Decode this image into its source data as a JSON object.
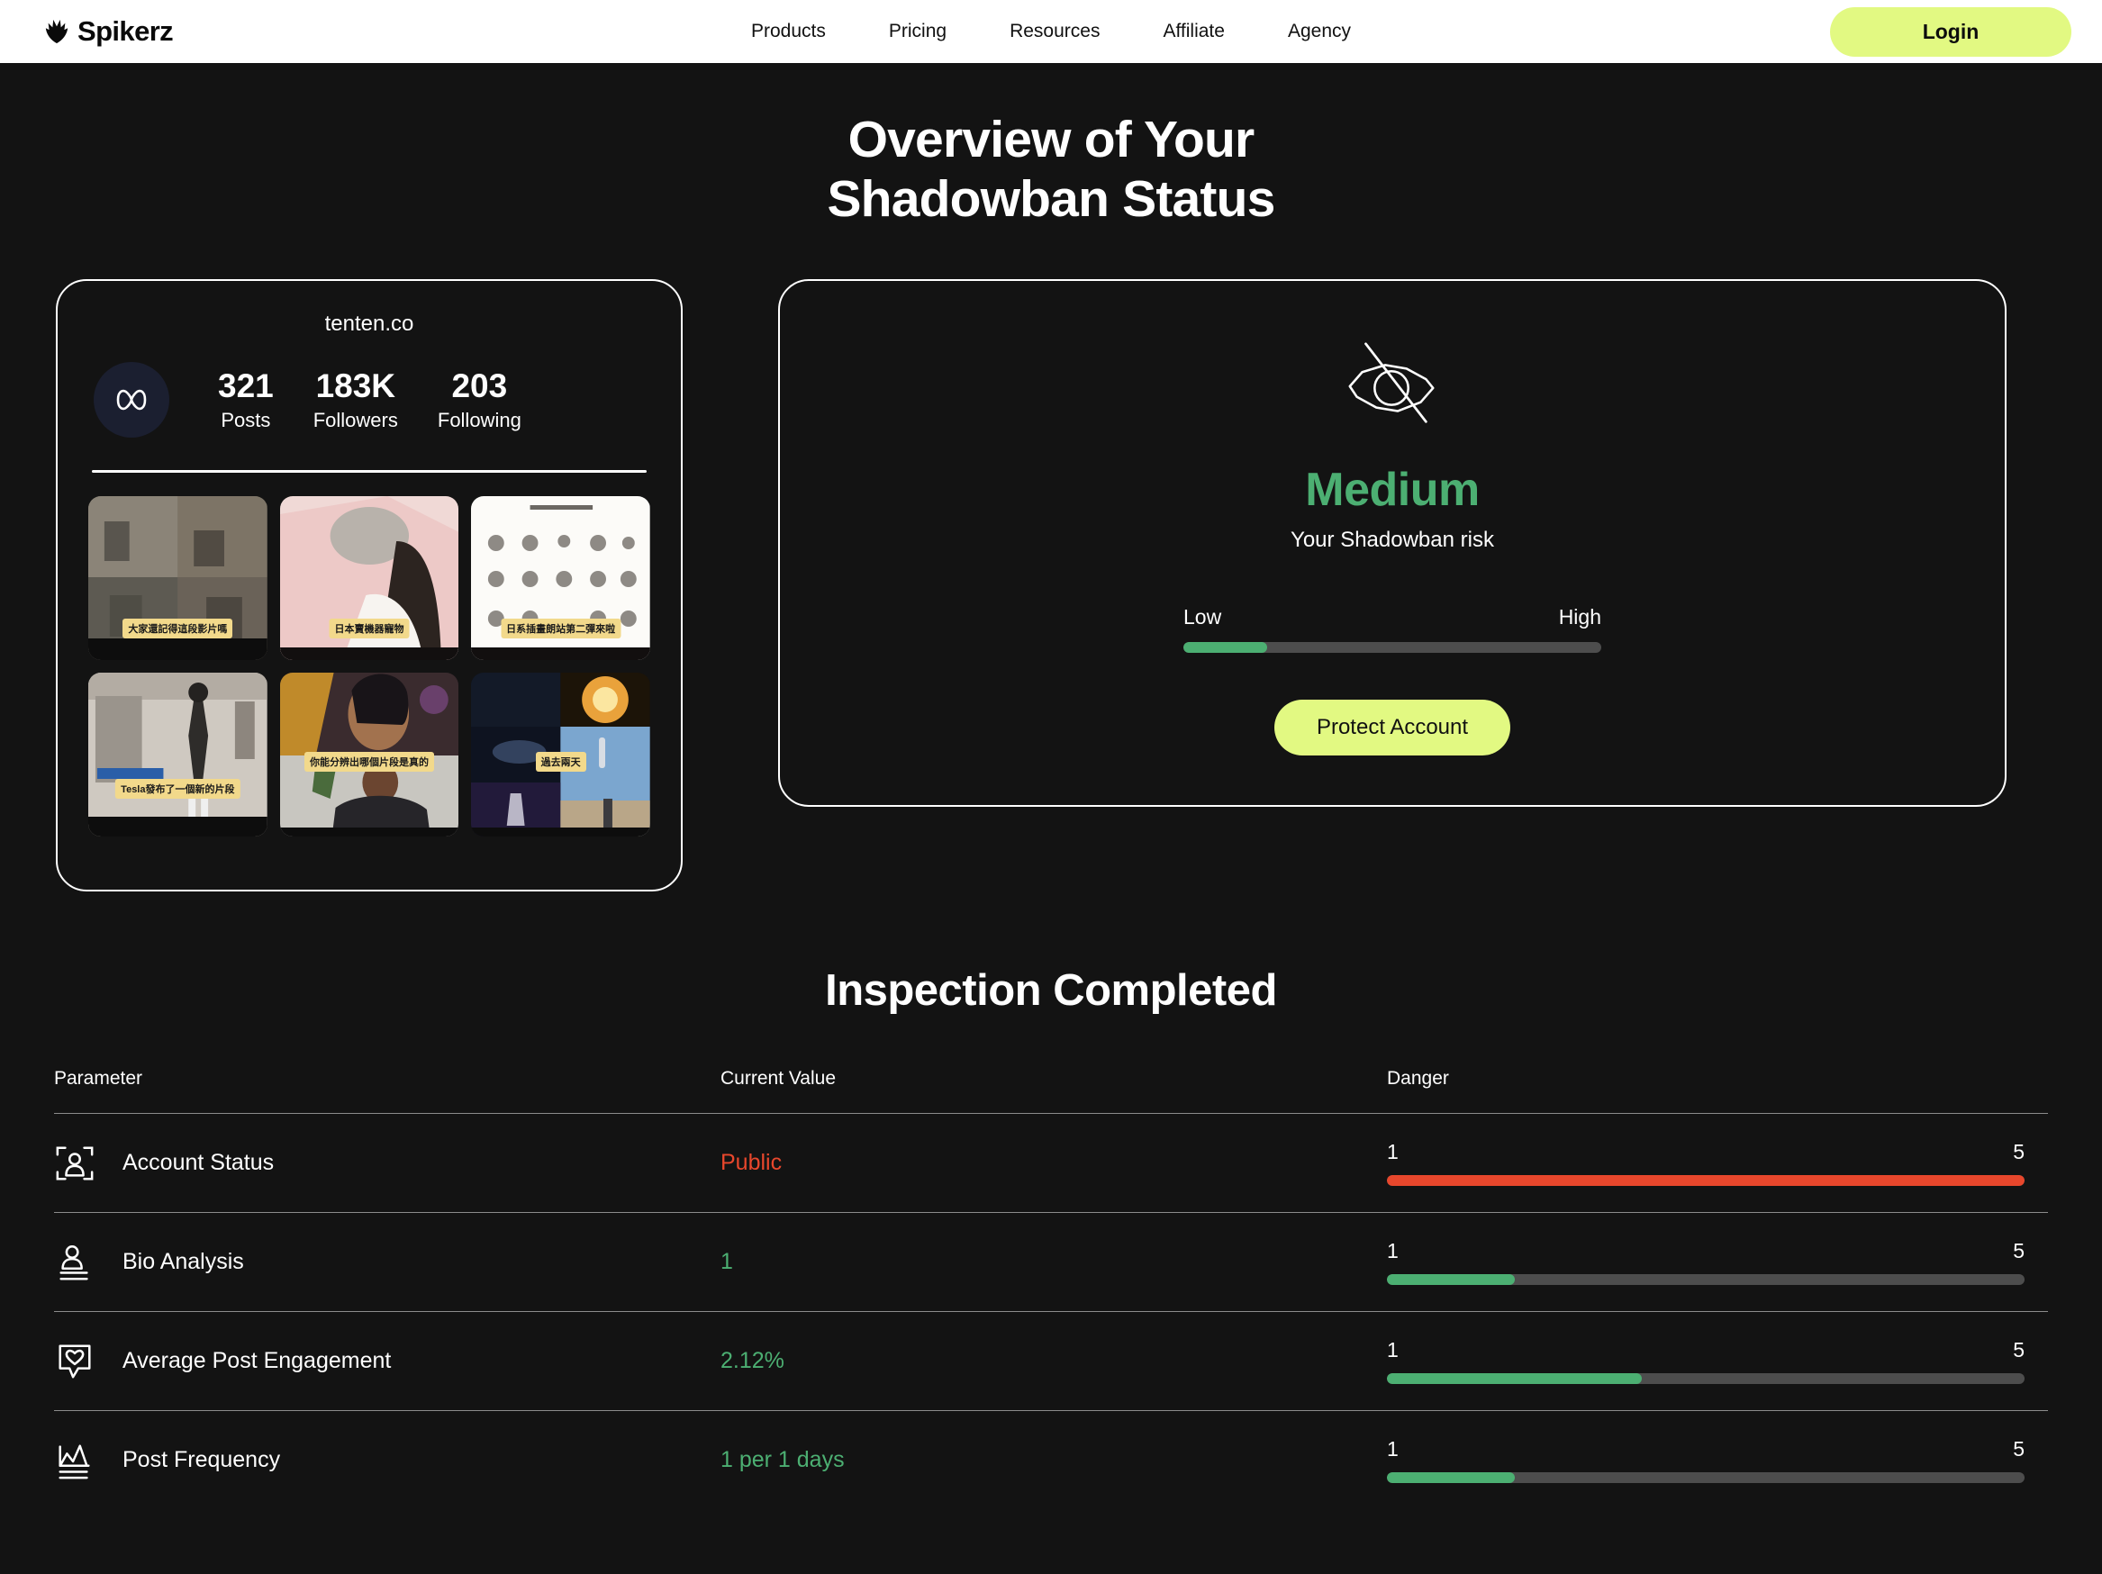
{
  "header": {
    "brand": "Spikerz",
    "nav": [
      {
        "label": "Products"
      },
      {
        "label": "Pricing"
      },
      {
        "label": "Resources"
      },
      {
        "label": "Affiliate"
      },
      {
        "label": "Agency"
      }
    ],
    "login_label": "Login"
  },
  "hero": {
    "title_line1": "Overview of Your",
    "title_line2": "Shadowban Status"
  },
  "profile": {
    "handle": "tenten.co",
    "stats": [
      {
        "value": "321",
        "label": "Posts"
      },
      {
        "value": "183K",
        "label": "Followers"
      },
      {
        "value": "203",
        "label": "Following"
      }
    ],
    "thumbnails": [
      {
        "caption": "大家還記得這段影片嗎"
      },
      {
        "caption": "日本賣機器寵物"
      },
      {
        "caption": "日系插畫朗站第二彈來啦"
      },
      {
        "caption": "Tesla發布了一個新的片段"
      },
      {
        "caption": "你能分辨出哪個片段是真的"
      },
      {
        "caption": "過去兩天"
      }
    ]
  },
  "risk": {
    "level": "Medium",
    "level_color": "#4caf72",
    "subtitle": "Your Shadowban risk",
    "scale_low": "Low",
    "scale_high": "High",
    "fill_percent": "20%",
    "fill_color": "#4caf72",
    "cta_label": "Protect Account"
  },
  "inspection": {
    "title": "Inspection Completed",
    "columns": {
      "parameter": "Parameter",
      "current_value": "Current Value",
      "danger": "Danger"
    },
    "rows": [
      {
        "icon": "scan-person-icon",
        "parameter": "Account Status",
        "value": "Public",
        "value_color": "#e8472c",
        "danger_min": "1",
        "danger_max": "5",
        "danger_percent": "100%",
        "danger_color": "#e8472c"
      },
      {
        "icon": "person-lines-icon",
        "parameter": "Bio Analysis",
        "value": "1",
        "value_color": "#4caf72",
        "danger_min": "1",
        "danger_max": "5",
        "danger_percent": "20%",
        "danger_color": "#4caf72"
      },
      {
        "icon": "heart-comment-icon",
        "parameter": "Average Post Engagement",
        "value": "2.12%",
        "value_color": "#4caf72",
        "danger_min": "1",
        "danger_max": "5",
        "danger_percent": "40%",
        "danger_color": "#4caf72"
      },
      {
        "icon": "chart-lines-icon",
        "parameter": "Post Frequency",
        "value": "1 per 1 days",
        "value_color": "#4caf72",
        "danger_min": "1",
        "danger_max": "5",
        "danger_percent": "20%",
        "danger_color": "#4caf72"
      }
    ]
  }
}
